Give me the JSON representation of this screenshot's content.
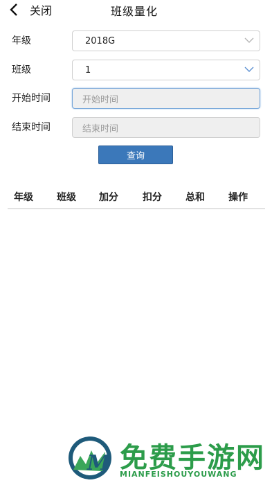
{
  "header": {
    "back_label": "关闭",
    "title": "班级量化"
  },
  "form": {
    "grade": {
      "label": "年级",
      "value": "2018G"
    },
    "class": {
      "label": "班级",
      "value": "1"
    },
    "start_time": {
      "label": "开始时间",
      "placeholder": "开始时间"
    },
    "end_time": {
      "label": "结束时间",
      "placeholder": "结束时间"
    },
    "query_label": "查询"
  },
  "table": {
    "columns": [
      "年级",
      "班级",
      "加分",
      "扣分",
      "总和",
      "操作"
    ]
  },
  "watermark": {
    "title": "免费手游网",
    "subtitle": "MIANFEISHOUYOUWANG"
  },
  "colors": {
    "accent": "#3b78ba",
    "watermark": "#2c9c4a"
  }
}
